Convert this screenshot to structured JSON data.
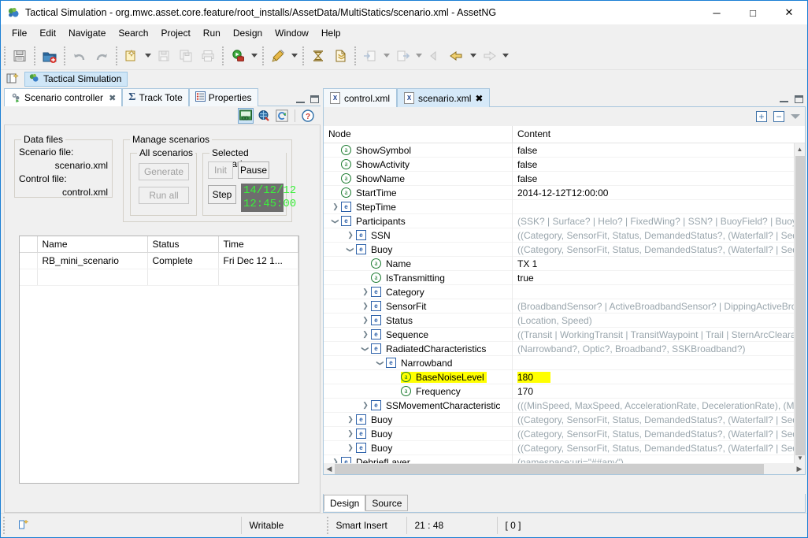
{
  "window": {
    "title": "Tactical Simulation - org.mwc.asset.core.feature/root_installs/AssetData/MultiStatics/scenario.xml - AssetNG",
    "app_icon": "asset-app-icon",
    "minimize_label": "─",
    "maximize_label": "□",
    "close_label": "✕"
  },
  "menu": {
    "items": [
      "File",
      "Edit",
      "Navigate",
      "Search",
      "Project",
      "Run",
      "Design",
      "Window",
      "Help"
    ]
  },
  "toolbar": {
    "groups": [
      {
        "buttons": [
          {
            "name": "save-icon",
            "enabled": true
          }
        ]
      },
      {
        "buttons": [
          {
            "name": "open-project-icon",
            "enabled": true
          }
        ]
      },
      {
        "buttons": [
          {
            "name": "undo-icon",
            "enabled": false
          },
          {
            "name": "redo-icon",
            "enabled": false
          }
        ]
      },
      {
        "buttons": [
          {
            "name": "new-wizard-icon",
            "enabled": true,
            "dropdown": true
          },
          {
            "name": "save-disabled-icon",
            "enabled": false
          },
          {
            "name": "save-all-icon",
            "enabled": false
          },
          {
            "name": "print-icon",
            "enabled": false
          }
        ]
      },
      {
        "buttons": [
          {
            "name": "debug-icon",
            "enabled": true,
            "dropdown": true
          }
        ]
      },
      {
        "buttons": [
          {
            "name": "run-icon",
            "enabled": true,
            "dropdown": true
          }
        ]
      },
      {
        "buttons": [
          {
            "name": "new-asset-icon",
            "enabled": true
          },
          {
            "name": "new-scenario-icon",
            "enabled": true
          }
        ]
      },
      {
        "buttons": [
          {
            "name": "import-icon",
            "enabled": false,
            "dropdown": true
          },
          {
            "name": "export-icon",
            "enabled": false,
            "dropdown": true
          }
        ]
      },
      {
        "buttons": [
          {
            "name": "back-small-icon",
            "enabled": false
          },
          {
            "name": "back-icon",
            "enabled": true,
            "dropdown": true
          },
          {
            "name": "forward-icon",
            "enabled": false,
            "dropdown": true
          }
        ]
      }
    ]
  },
  "perspective": {
    "label": "Tactical Simulation",
    "new_perspective_icon": "open-perspective-icon"
  },
  "left_view": {
    "tabs": [
      {
        "label": "Scenario controller",
        "icon": "scenario-controller-icon",
        "active": true,
        "closable": true
      },
      {
        "label": "Track Tote",
        "icon": "sigma-icon",
        "active": false,
        "closable": false
      },
      {
        "label": "Properties",
        "icon": "properties-icon",
        "active": false,
        "closable": false
      }
    ],
    "view_toolbar": [
      {
        "name": "link-with-editor-icon",
        "selected": true
      },
      {
        "name": "view-scenario-icon",
        "selected": false
      },
      {
        "name": "restart-icon",
        "selected": false
      },
      {
        "name": "help-icon",
        "selected": false
      }
    ],
    "data_files": {
      "group_title": "Data files",
      "scenario_label": "Scenario file:",
      "scenario_value": "scenario.xml",
      "control_label": "Control file:",
      "control_value": "control.xml"
    },
    "manage_scenarios": {
      "group_title": "Manage scenarios",
      "all_scenarios": {
        "group_title": "All scenarios",
        "buttons": [
          {
            "label": "Generate",
            "enabled": false
          },
          {
            "label": "Run all",
            "enabled": false
          }
        ]
      },
      "selected_scenario": {
        "group_title": "Selected scenario",
        "buttons": [
          {
            "label": "Init",
            "enabled": false
          },
          {
            "label": "Pause",
            "enabled": true
          },
          {
            "label": "Step",
            "enabled": true
          }
        ],
        "time_display": {
          "date": "14/12/12",
          "time": "12:45:00"
        }
      }
    },
    "table": {
      "columns": [
        "Name",
        "Status",
        "Time"
      ],
      "rows": [
        {
          "name": "RB_mini_scenario",
          "status": "Complete",
          "time": "Fri Dec 12 1..."
        }
      ]
    }
  },
  "editor": {
    "tabs": [
      {
        "label": "control.xml",
        "icon": "xml-file-icon",
        "active": false,
        "closable": false
      },
      {
        "label": "scenario.xml",
        "icon": "xml-file-icon",
        "active": true,
        "closable": true
      }
    ],
    "tool_icons": [
      {
        "name": "expand-all-icon",
        "glyph": "+"
      },
      {
        "name": "collapse-all-icon",
        "glyph": "−"
      },
      {
        "name": "view-menu-icon",
        "glyph": "▽"
      }
    ],
    "tree_columns": [
      "Node",
      "Content"
    ],
    "tree_rows": [
      {
        "indent": 1,
        "kind": "attribute",
        "label": "ShowSymbol",
        "content": "false",
        "grey": false,
        "twisty": "none"
      },
      {
        "indent": 1,
        "kind": "attribute",
        "label": "ShowActivity",
        "content": "false",
        "grey": false,
        "twisty": "none"
      },
      {
        "indent": 1,
        "kind": "attribute",
        "label": "ShowName",
        "content": "false",
        "grey": false,
        "twisty": "none"
      },
      {
        "indent": 1,
        "kind": "attribute",
        "label": "StartTime",
        "content": "2014-12-12T12:00:00",
        "grey": false,
        "twisty": "none"
      },
      {
        "indent": 1,
        "kind": "element",
        "label": "StepTime",
        "content": "",
        "grey": false,
        "twisty": "collapsed"
      },
      {
        "indent": 1,
        "kind": "element",
        "label": "Participants",
        "content": "(SSK? | Surface? | Helo? | FixedWing? | SSN? | BuoyField? | Buoy? | T",
        "grey": true,
        "twisty": "expanded"
      },
      {
        "indent": 2,
        "kind": "element",
        "label": "SSN",
        "content": "((Category, SensorFit, Status, DemandedStatus?, (Waterfall? | Sequ",
        "grey": true,
        "twisty": "collapsed"
      },
      {
        "indent": 2,
        "kind": "element",
        "label": "Buoy",
        "content": "((Category, SensorFit, Status, DemandedStatus?, (Waterfall? | Sequ",
        "grey": true,
        "twisty": "expanded"
      },
      {
        "indent": 3,
        "kind": "attribute",
        "label": "Name",
        "content": "TX 1",
        "grey": false,
        "twisty": "none"
      },
      {
        "indent": 3,
        "kind": "attribute",
        "label": "IsTransmitting",
        "content": "true",
        "grey": false,
        "twisty": "none"
      },
      {
        "indent": 3,
        "kind": "element",
        "label": "Category",
        "content": "",
        "grey": false,
        "twisty": "collapsed"
      },
      {
        "indent": 3,
        "kind": "element",
        "label": "SensorFit",
        "content": "(BroadbandSensor? | ActiveBroadbandSensor? | DippingActiveBro",
        "grey": true,
        "twisty": "collapsed"
      },
      {
        "indent": 3,
        "kind": "element",
        "label": "Status",
        "content": "(Location, Speed)",
        "grey": true,
        "twisty": "collapsed"
      },
      {
        "indent": 3,
        "kind": "element",
        "label": "Sequence",
        "content": "((Transit | WorkingTransit | TransitWaypoint | Trail | SternArcCleara",
        "grey": true,
        "twisty": "collapsed"
      },
      {
        "indent": 3,
        "kind": "element",
        "label": "RadiatedCharacteristics",
        "content": "(Narrowband?, Optic?, Broadband?, SSKBroadband?)",
        "grey": true,
        "twisty": "expanded"
      },
      {
        "indent": 4,
        "kind": "element",
        "label": "Narrowband",
        "content": "",
        "grey": false,
        "twisty": "expanded"
      },
      {
        "indent": 5,
        "kind": "attribute",
        "label": "BaseNoiseLevel",
        "content": "180",
        "grey": false,
        "twisty": "none",
        "highlight": true
      },
      {
        "indent": 5,
        "kind": "attribute",
        "label": "Frequency",
        "content": "170",
        "grey": false,
        "twisty": "none"
      },
      {
        "indent": 3,
        "kind": "element",
        "label": "SSMovementCharacteristic",
        "content": "(((MinSpeed, MaxSpeed, AccelerationRate, DecelerationRate), (Mi",
        "grey": true,
        "twisty": "collapsed"
      },
      {
        "indent": 2,
        "kind": "element",
        "label": "Buoy",
        "content": "((Category, SensorFit, Status, DemandedStatus?, (Waterfall? | Sequ",
        "grey": true,
        "twisty": "collapsed"
      },
      {
        "indent": 2,
        "kind": "element",
        "label": "Buoy",
        "content": "((Category, SensorFit, Status, DemandedStatus?, (Waterfall? | Sequ",
        "grey": true,
        "twisty": "collapsed"
      },
      {
        "indent": 2,
        "kind": "element",
        "label": "Buoy",
        "content": "((Category, SensorFit, Status, DemandedStatus?, (Waterfall? | Sequ",
        "grey": true,
        "twisty": "collapsed"
      },
      {
        "indent": 1,
        "kind": "element",
        "label": "DebriefLayer",
        "content": "(namespace:uri=\"##any\")",
        "grey": true,
        "twisty": "collapsed"
      }
    ],
    "bottom_tabs": [
      {
        "label": "Design",
        "active": true
      },
      {
        "label": "Source",
        "active": false
      }
    ]
  },
  "status_bar": {
    "left_icon": "editor-state-icon",
    "writable": "Writable",
    "insert_mode": "Smart Insert",
    "position": "21 : 48",
    "selection": "[ 0 ]"
  },
  "colors": {
    "accent": "#1a7fd4",
    "highlight": "#ffff00",
    "time_text": "#3bf03b",
    "time_bg": "#6e6e6e",
    "attribute_icon": "#1a7a2e",
    "element_icon": "#2a5fa8",
    "grey_content": "#9aa6ad"
  }
}
